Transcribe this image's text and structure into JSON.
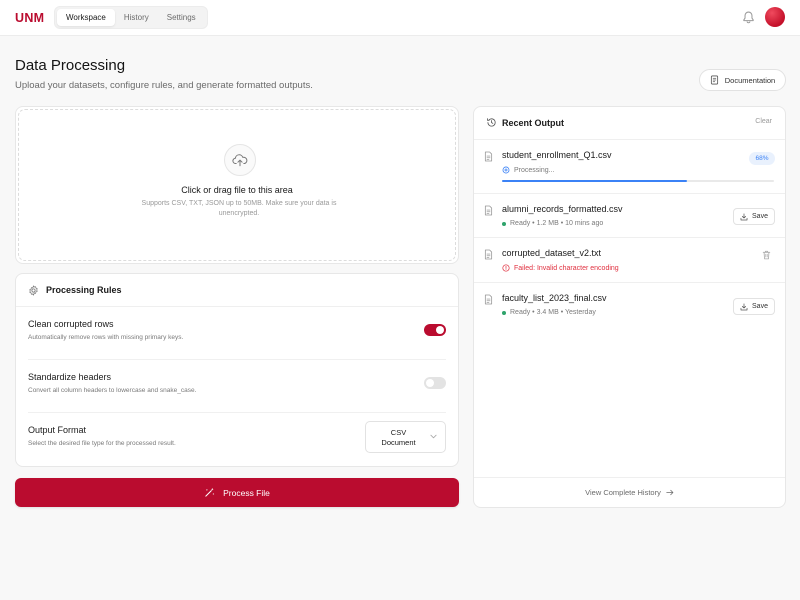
{
  "header": {
    "logo": "UNM",
    "tabs": [
      {
        "label": "Workspace",
        "active": true
      },
      {
        "label": "History",
        "active": false
      },
      {
        "label": "Settings",
        "active": false
      }
    ],
    "icons": {
      "notifications": "bell-icon",
      "avatar": "user-avatar"
    }
  },
  "page": {
    "title": "Data Processing",
    "subtitle": "Upload your datasets, configure rules, and generate formatted outputs.",
    "documentation_label": "Documentation"
  },
  "upload": {
    "title": "Click or drag file to this area",
    "description": "Supports CSV, TXT, JSON up to 50MB. Make sure your data is unencrypted."
  },
  "rules": {
    "title": "Processing Rules",
    "items": [
      {
        "title": "Clean corrupted rows",
        "description": "Automatically remove rows with missing primary keys.",
        "enabled": true
      },
      {
        "title": "Standardize headers",
        "description": "Convert all column headers to lowercase and snake_case.",
        "enabled": false
      }
    ],
    "output_format": {
      "title": "Output Format",
      "description": "Select the desired file type for the processed result.",
      "selected": "CSV Document"
    }
  },
  "process_button": "Process File",
  "output": {
    "title": "Recent Output",
    "clear_label": "Clear",
    "items": [
      {
        "name": "student_enrollment_Q1.csv",
        "status": "Processing...",
        "progress_label": "68%",
        "progress": 0.68
      },
      {
        "name": "alumni_records_formatted.csv",
        "meta": "Ready • 1.2 MB • 10 mins ago",
        "action": "Save"
      },
      {
        "name": "corrupted_dataset_v2.txt",
        "meta": "Failed: Invalid character encoding"
      },
      {
        "name": "faculty_list_2023_final.csv",
        "meta": "Ready • 3.4 MB • Yesterday",
        "action": "Save"
      }
    ],
    "footer_link": "View Complete History"
  },
  "colors": {
    "brand": "#ba0c2f",
    "progress": "#3b82f6",
    "success": "#2ea36b",
    "error": "#e0303f"
  }
}
